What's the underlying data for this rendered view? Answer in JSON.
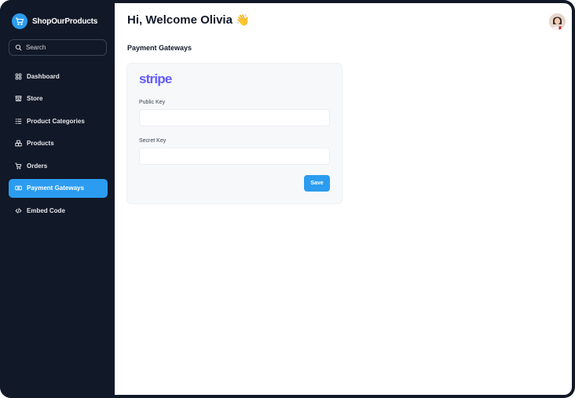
{
  "brand": {
    "name": "ShopOurProducts",
    "icon": "cart-icon",
    "accent": "#2b9cf0"
  },
  "search": {
    "placeholder": "Search",
    "icon": "search-icon"
  },
  "sidebar": {
    "items": [
      {
        "label": "Dashboard",
        "icon": "grid-icon",
        "active": false
      },
      {
        "label": "Store",
        "icon": "store-icon",
        "active": false
      },
      {
        "label": "Product Categories",
        "icon": "list-icon",
        "active": false
      },
      {
        "label": "Products",
        "icon": "boxes-icon",
        "active": false
      },
      {
        "label": "Orders",
        "icon": "cart-icon",
        "active": false
      },
      {
        "label": "Payment Gateways",
        "icon": "money-icon",
        "active": true
      },
      {
        "label": "Embed Code",
        "icon": "code-icon",
        "active": false
      }
    ]
  },
  "header": {
    "greeting": "Hi, Welcome Olivia",
    "emoji": "👋"
  },
  "main": {
    "section_title": "Payment Gateways",
    "gateway": {
      "logo_text": "stripe",
      "public_key_label": "Public Key",
      "public_key_value": "",
      "secret_key_label": "Secret Key",
      "secret_key_value": "",
      "save_label": "Save"
    }
  },
  "colors": {
    "sidebar_bg": "#111827",
    "active_bg": "#2b9cf0",
    "stripe": "#635bff"
  }
}
